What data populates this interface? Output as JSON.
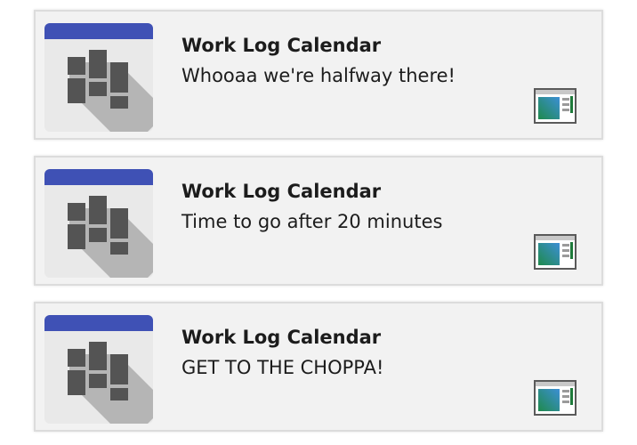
{
  "notifications": [
    {
      "app_name": "Work Log Calendar",
      "message": "Whooaa we're halfway there!",
      "app_icon": "work-log-calendar-icon",
      "badge_icon": "app-window-icon"
    },
    {
      "app_name": "Work Log Calendar",
      "message": "Time to go after 20 minutes",
      "app_icon": "work-log-calendar-icon",
      "badge_icon": "app-window-icon"
    },
    {
      "app_name": "Work Log Calendar",
      "message": "GET TO THE CHOPPA!",
      "app_icon": "work-log-calendar-icon",
      "badge_icon": "app-window-icon"
    }
  ],
  "colors": {
    "icon_header": "#3f51b5",
    "icon_body": "#e9e9e9",
    "icon_blocks": "#545454",
    "icon_shadow": "#b5b5b5",
    "toast_background": "#f2f2f2"
  }
}
